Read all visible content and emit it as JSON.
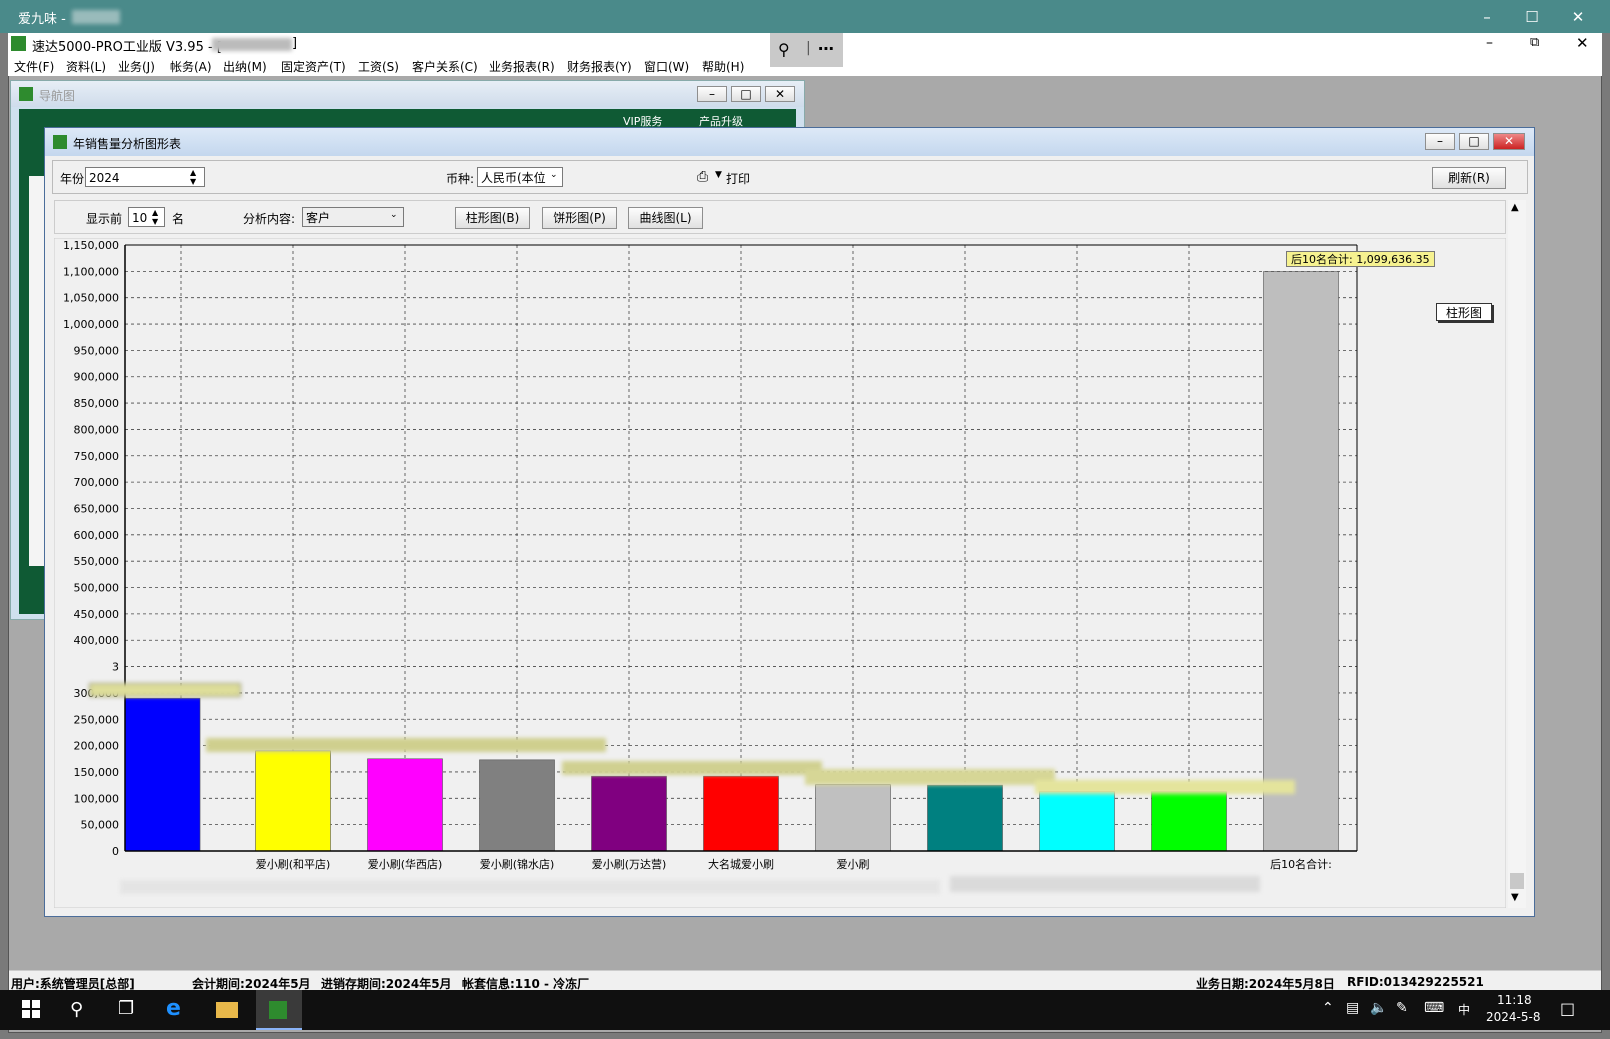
{
  "outer_window": {
    "title": "爱九味 -"
  },
  "app": {
    "title": "速达5000-PRO工业版 V3.95 - [",
    "title_end": "]",
    "menus": [
      "文件(F)",
      "资料(L)",
      "业务(J)",
      "帐务(A)",
      "出纳(M)",
      "固定资产(T)",
      "工资(S)",
      "客户关系(C)",
      "业务报表(R)",
      "财务报表(Y)",
      "窗口(W)",
      "帮助(H)"
    ]
  },
  "nav_window": {
    "title": "导航图",
    "vip": "VIP服务",
    "upgrade": "产品升级"
  },
  "sales_window": {
    "title": "年销售量分析图形表",
    "year_label": "年份",
    "year_value": "2024",
    "currency_label": "币种:",
    "currency_value": "人民币(本位",
    "print_label": "打印",
    "refresh_label": "刷新(R)",
    "show_top_label": "显示前",
    "show_top_value": "10",
    "show_top_unit": "名",
    "analysis_label": "分析内容:",
    "analysis_value": "客户",
    "bar_button": "柱形图(B)",
    "pie_button": "饼形图(P)",
    "line_button": "曲线图(L)",
    "legend_label": "柱形图",
    "total_callout": "后10名合计: 1,099,636.35"
  },
  "chart_data": {
    "type": "bar",
    "categories": [
      "",
      "爱小刷(和平店)",
      "爱小刷(华西店)",
      "爱小刷(锦水店)",
      "爱小刷(万达营)",
      "大名城爱小刷",
      "爱小刷",
      "",
      "",
      "",
      "后10名合计:"
    ],
    "values": [
      290000,
      190000,
      175000,
      173000,
      142000,
      142000,
      126000,
      125000,
      113000,
      113000,
      1099636.35
    ],
    "colors": [
      "#0000ff",
      "#ffff00",
      "#ff00ff",
      "#808080",
      "#800080",
      "#ff0000",
      "#c0c0c0",
      "#008080",
      "#00ffff",
      "#00ff00",
      "#bebebe"
    ],
    "yticks": [
      "0",
      "50,000",
      "100,000",
      "150,000",
      "200,000",
      "250,000",
      "300,000",
      "3",
      "400,000",
      "450,000",
      "500,000",
      "550,000",
      "600,000",
      "650,000",
      "700,000",
      "750,000",
      "800,000",
      "850,000",
      "900,000",
      "950,000",
      "1,000,000",
      "1,050,000",
      "1,100,000",
      "1,150,000"
    ],
    "ylim": [
      0,
      1150000
    ],
    "grid": true,
    "legend": "right"
  },
  "status": {
    "user": "用户:系统管理员[总部]",
    "period": "会计期间:2024年5月",
    "stock_period": "进销存期间:2024年5月",
    "account": "帐套信息:110 - 冷冻厂",
    "biz_date": "业务日期:2024年5月8日",
    "rfid": "RFID:013429225521"
  },
  "taskbar": {
    "time": "11:18",
    "date": "2024-5-8",
    "ime": "中"
  }
}
